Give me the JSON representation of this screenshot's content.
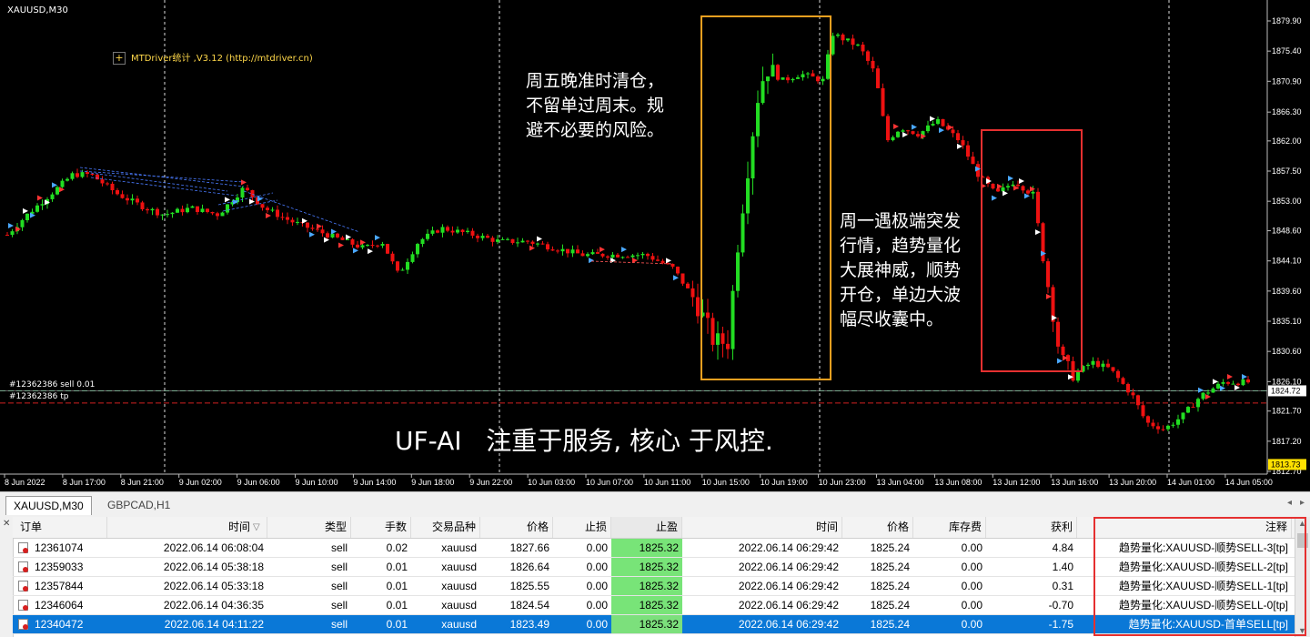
{
  "chart": {
    "symbol": "XAUUSD,M30",
    "indicator": "MTDriver统计 ,V3.12 (http://mtdriver.cn)",
    "prices": [
      "1879.90",
      "1875.40",
      "1870.90",
      "1866.30",
      "1862.00",
      "1857.50",
      "1853.00",
      "1848.60",
      "1844.10",
      "1839.60",
      "1835.10",
      "1830.60",
      "1826.10",
      "1821.70",
      "1817.20",
      "1812.70"
    ],
    "price_tags": {
      "current": "1824.72",
      "bid": "1813.73"
    },
    "time_labels": [
      "8 Jun 2022",
      "8 Jun 17:00",
      "8 Jun 21:00",
      "9 Jun 02:00",
      "9 Jun 06:00",
      "9 Jun 10:00",
      "9 Jun 14:00",
      "9 Jun 18:00",
      "9 Jun 22:00",
      "10 Jun 03:00",
      "10 Jun 07:00",
      "10 Jun 11:00",
      "10 Jun 15:00",
      "10 Jun 19:00",
      "10 Jun 23:00",
      "13 Jun 04:00",
      "13 Jun 08:00",
      "13 Jun 12:00",
      "13 Jun 16:00",
      "13 Jun 20:00",
      "14 Jun 01:00",
      "14 Jun 05:00"
    ],
    "order_label": "#12362386 sell 0.01",
    "tp_label": "#12362386 tp",
    "annotation_friday": "周五晚准时清仓，\n不留单过周末。规\n避不必要的风险。",
    "annotation_monday": "周一遇极端突发\n行情，趋势量化\n大展神威，顺势\n开仓，单边大波\n幅尽收囊中。",
    "slogan": "UF-AI   注重于服务, 核心 于风控.",
    "colors": {
      "bull": "#22dd22",
      "bear": "#ee1111",
      "orange_box": "#f0a020",
      "red_box": "#e53030"
    }
  },
  "tabs": [
    {
      "label": "XAUUSD,M30",
      "active": true
    },
    {
      "label": "GBPCAD,H1",
      "active": false
    }
  ],
  "table": {
    "columns": [
      "订单",
      "时间",
      "类型",
      "手数",
      "交易品种",
      "价格",
      "止损",
      "止盈",
      "时间",
      "价格",
      "库存费",
      "获利",
      "注释"
    ],
    "rows": [
      {
        "order": "12361074",
        "open_time": "2022.06.14 06:08:04",
        "type": "sell",
        "lots": "0.02",
        "symbol": "xauusd",
        "open_price": "1827.66",
        "sl": "0.00",
        "tp": "1825.32",
        "close_time": "2022.06.14 06:29:42",
        "close_price": "1825.24",
        "swap": "0.00",
        "profit": "4.84",
        "comment": "趋势量化:XAUUSD-顺势SELL-3[tp]"
      },
      {
        "order": "12359033",
        "open_time": "2022.06.14 05:38:18",
        "type": "sell",
        "lots": "0.01",
        "symbol": "xauusd",
        "open_price": "1826.64",
        "sl": "0.00",
        "tp": "1825.32",
        "close_time": "2022.06.14 06:29:42",
        "close_price": "1825.24",
        "swap": "0.00",
        "profit": "1.40",
        "comment": "趋势量化:XAUUSD-顺势SELL-2[tp]"
      },
      {
        "order": "12357844",
        "open_time": "2022.06.14 05:33:18",
        "type": "sell",
        "lots": "0.01",
        "symbol": "xauusd",
        "open_price": "1825.55",
        "sl": "0.00",
        "tp": "1825.32",
        "close_time": "2022.06.14 06:29:42",
        "close_price": "1825.24",
        "swap": "0.00",
        "profit": "0.31",
        "comment": "趋势量化:XAUUSD-顺势SELL-1[tp]"
      },
      {
        "order": "12346064",
        "open_time": "2022.06.14 04:36:35",
        "type": "sell",
        "lots": "0.01",
        "symbol": "xauusd",
        "open_price": "1824.54",
        "sl": "0.00",
        "tp": "1825.32",
        "close_time": "2022.06.14 06:29:42",
        "close_price": "1825.24",
        "swap": "0.00",
        "profit": "-0.70",
        "comment": "趋势量化:XAUUSD-顺势SELL-0[tp]"
      },
      {
        "order": "12340472",
        "open_time": "2022.06.14 04:11:22",
        "type": "sell",
        "lots": "0.01",
        "symbol": "xauusd",
        "open_price": "1823.49",
        "sl": "0.00",
        "tp": "1825.32",
        "close_time": "2022.06.14 06:29:42",
        "close_price": "1825.24",
        "swap": "0.00",
        "profit": "-1.75",
        "comment": "趋势量化:XAUUSD-首单SELL[tp]"
      }
    ]
  }
}
